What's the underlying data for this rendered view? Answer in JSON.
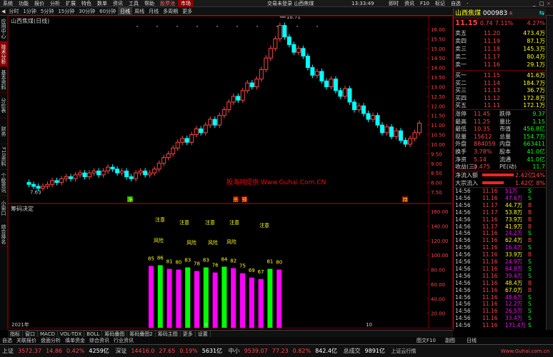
{
  "menu": [
    "系统",
    "功能",
    "报价",
    "分析",
    "扩展",
    "特色",
    "数单",
    "资讯",
    "工具",
    "帮助",
    "股票池",
    "市场"
  ],
  "window_title": "交易未登录  山西焦煤",
  "clock": "13:33:49",
  "top_right_menu": [
    "即时",
    "资讯",
    "F10",
    "标记",
    "自选",
    "-"
  ],
  "toolbar": [
    "分时",
    "1分钟",
    "5分钟",
    "15分钟",
    "30分钟",
    "60分钟",
    "日线",
    "周线",
    "月线",
    "多周期",
    "更多"
  ],
  "side_tabs": [
    "应用中心",
    "技术分析",
    "基本资料",
    "分价表",
    "财务",
    "F10资料",
    "个股资讯",
    "小窗口",
    "综合排名"
  ],
  "chart_title": "山西焦煤(日线)",
  "price_axis": [
    "16.00",
    "15.50",
    "15.00",
    "14.50",
    "14.00",
    "13.50",
    "13.00",
    "12.50",
    "12.00",
    "11.50",
    "11.00",
    "10.50",
    "10.00",
    "9.50",
    "9.00",
    "8.50",
    "8.00",
    "7.50"
  ],
  "high_label": "16.71",
  "low_label": "7.63",
  "watermark": "股海网提供 Www.Guhai.Com.CN",
  "markers": [
    "净",
    "杀",
    "预",
    "持"
  ],
  "sub_title": "筹码决定",
  "sub_axis": [
    "160.00",
    "140.00",
    "120.00",
    "100.00",
    "80.00",
    "60.00",
    "40.00",
    "20.00"
  ],
  "bars": {
    "values": [
      85,
      86,
      81,
      80,
      83,
      78,
      83,
      76,
      84,
      82,
      75,
      69,
      67,
      81,
      80
    ],
    "colors": [
      "mag",
      "grn",
      "mag",
      "mag",
      "grn",
      "mag",
      "grn",
      "mag",
      "grn",
      "mag",
      "mag",
      "mag",
      "mag",
      "grn",
      "mag"
    ]
  },
  "annotations_top": [
    "注意",
    "注意",
    "注意",
    "注意",
    "注意"
  ],
  "annotations_mid": [
    "风险",
    "风险",
    "风险",
    "风险"
  ],
  "x_axis": [
    "2021年",
    "9",
    "10"
  ],
  "bottom_tabs": [
    "指标",
    "窗口",
    "MACD",
    "VOL-TDX",
    "BOLL",
    "筹码叠图",
    "筹码叠图2",
    "筹码主图",
    "更多",
    "设置"
  ],
  "tab_row2": [
    "自选",
    "关联报价",
    "盘面分析",
    "填单资金",
    "综合资讯",
    "行业资讯"
  ],
  "right_bottom": [
    "图文F10",
    "副图",
    "日线"
  ],
  "quote": {
    "name": "山西焦煤",
    "code": "000983",
    "badge": "R",
    "price": "11.15",
    "change": "0.74",
    "pct": "7.11%",
    "side": "4.27%",
    "asks": [
      {
        "l": "卖五",
        "p": "11.20",
        "v": "473.4万"
      },
      {
        "l": "卖四",
        "p": "11.19",
        "v": "87.1万"
      },
      {
        "l": "卖三",
        "p": "11.18",
        "v": "145.3万"
      },
      {
        "l": "卖二",
        "p": "11.17",
        "v": "80.4万"
      },
      {
        "l": "卖一",
        "p": "11.16",
        "v": "29.1万"
      }
    ],
    "bids": [
      {
        "l": "买一",
        "p": "11.15",
        "v": "41.6万"
      },
      {
        "l": "买二",
        "p": "11.14",
        "v": "184.7万"
      },
      {
        "l": "买三",
        "p": "11.13",
        "v": "36.7万"
      },
      {
        "l": "买四",
        "p": "11.12",
        "v": "172.8万"
      },
      {
        "l": "买五",
        "p": "11.11",
        "v": "172.1万"
      }
    ],
    "stats": [
      {
        "a": "涨停",
        "av": "11.45",
        "b": "跌停",
        "bv": "9.37"
      },
      {
        "a": "最高",
        "av": "11.25",
        "b": "量比",
        "bv": "1.15"
      },
      {
        "a": "最低",
        "av": "10.35",
        "b": "市值",
        "bv": "456.8亿"
      },
      {
        "a": "现量",
        "av": "15612",
        "b": "总量",
        "bv": "154.7万"
      },
      {
        "a": "外盘",
        "av": "884059",
        "b": "内盘",
        "bv": "663411"
      },
      {
        "a": "换手",
        "av": "3.78%",
        "b": "股本",
        "bv": "41.0亿"
      },
      {
        "a": "净资",
        "av": "5.14",
        "b": "流通",
        "bv": "41.0亿"
      },
      {
        "a": "收益(三)",
        "av": "0.475",
        "b": "PE(动)",
        "bv": "11.7"
      }
    ],
    "flows": [
      {
        "l": "净流入额",
        "v": "2.42亿",
        "p": "14%"
      },
      {
        "l": "大宗流入",
        "v": "1.42亿",
        "p": "8%"
      }
    ],
    "ticks": [
      [
        "14:56",
        "11.16",
        "51万",
        "S"
      ],
      [
        "14:56",
        "11.16",
        "47.6万",
        "S"
      ],
      [
        "14:56",
        "11.17",
        "44.7万",
        "B"
      ],
      [
        "14:56",
        "11.17",
        "53.8万",
        "B"
      ],
      [
        "14:56",
        "11.16",
        "73.9万",
        "B"
      ],
      [
        "14:56",
        "11.17",
        "41.9万",
        "B"
      ],
      [
        "14:56",
        "11.16",
        "24.2万",
        "S"
      ],
      [
        "14:56",
        "11.16",
        "62.4万",
        "B"
      ],
      [
        "14:56",
        "11.16",
        "16.4万",
        "S"
      ],
      [
        "14:56",
        "11.16",
        "33.9万",
        "B"
      ],
      [
        "14:56",
        "11.16",
        "24.9万",
        "S"
      ],
      [
        "14:56",
        "11.16",
        "64.8万",
        "S"
      ],
      [
        "14:56",
        "11.16",
        "39.4万",
        "S"
      ],
      [
        "14:56",
        "11.16",
        "48.4万",
        "B"
      ],
      [
        "14:56",
        "11.16",
        "67.0万",
        "B"
      ],
      [
        "14:56",
        "11.16",
        "48.6万",
        "S"
      ],
      [
        "14:56",
        "11.16",
        "12.2万",
        "S"
      ],
      [
        "14:56",
        "11.16",
        "26.5万",
        "S"
      ],
      [
        "14:56",
        "11.16",
        "33.4万",
        "S"
      ],
      [
        "14:56",
        "11.16",
        "171.4万",
        "S"
      ]
    ]
  },
  "status": {
    "sh_label": "上证",
    "sh_val": "3572.37",
    "sh_chg": "14.86",
    "sh_pct": "0.42%",
    "sh_amt": "4259亿",
    "sz_label": "深证",
    "sz_val": "14416.0",
    "sz_chg": "27.65",
    "sz_pct": "0.19%",
    "sz_amt": "5631亿",
    "zx_label": "中小",
    "zx_val": "9539.07",
    "zx_chg": "77.23",
    "zx_pct": "0.82%",
    "zx_amt": "842.4亿",
    "cy_label": "总成交",
    "cy_amt": "9891亿",
    "info": "上证云行情",
    "site": "Www.Guhai.com.cn"
  }
}
